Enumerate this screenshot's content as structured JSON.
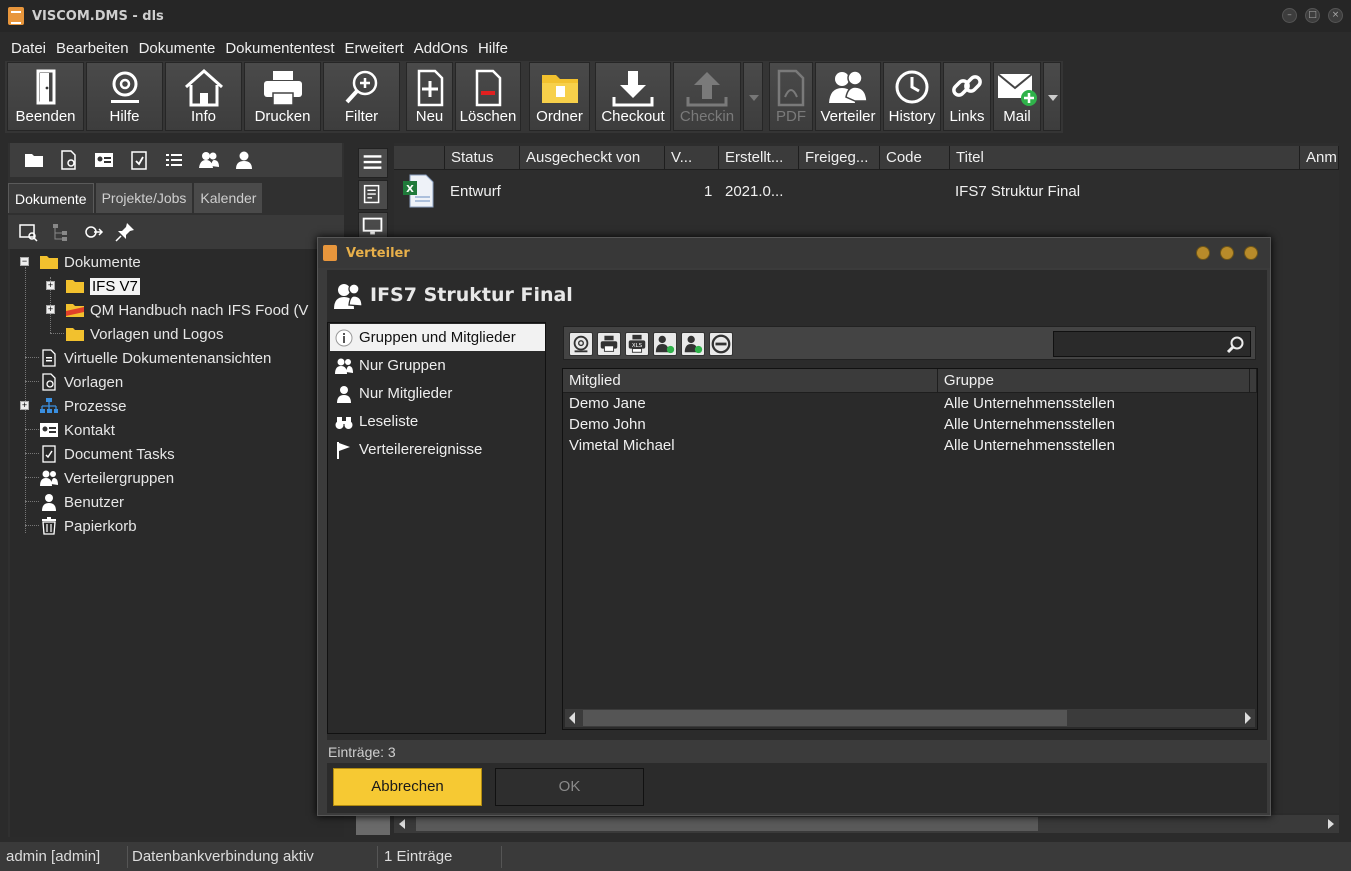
{
  "window": {
    "title": "VISCOM.DMS - dls"
  },
  "menu": [
    "Datei",
    "Bearbeiten",
    "Dokumente",
    "Dokumententest",
    "Erweitert",
    "AddOns",
    "Hilfe"
  ],
  "toolbar": {
    "beenden": "Beenden",
    "hilfe": "Hilfe",
    "info": "Info",
    "drucken": "Drucken",
    "filter": "Filter",
    "neu": "Neu",
    "loeschen": "Löschen",
    "ordner": "Ordner",
    "checkout": "Checkout",
    "checkin": "Checkin",
    "pdf": "PDF",
    "verteiler": "Verteiler",
    "history": "History",
    "links": "Links",
    "mail": "Mail"
  },
  "left_tabs": [
    "Dokumente",
    "Projekte/Jobs",
    "Kalender"
  ],
  "tree": {
    "dokumente": "Dokumente",
    "ifs": "IFS V7",
    "qm": "QM Handbuch nach IFS Food (V",
    "vorlagen_logos": "Vorlagen und Logos",
    "virtuelle": "Virtuelle Dokumentenansichten",
    "vorlagen": "Vorlagen",
    "prozesse": "Prozesse",
    "kontakt": "Kontakt",
    "tasks": "Document Tasks",
    "verteilergruppen": "Verteilergruppen",
    "benutzer": "Benutzer",
    "papierkorb": "Papierkorb"
  },
  "grid": {
    "columns": [
      "Status",
      "Ausgecheckt von",
      "V...",
      "Erstellt...",
      "Freigeg...",
      "Code",
      "Titel",
      "Anm"
    ],
    "row": {
      "status": "Entwurf",
      "version": "1",
      "created": "2021.0...",
      "title": "IFS7 Struktur Final"
    }
  },
  "dialog": {
    "title": "Verteiler",
    "header": "IFS7 Struktur Final",
    "nav": [
      "Gruppen und Mitglieder",
      "Nur Gruppen",
      "Nur Mitglieder",
      "Leseliste",
      "Verteilerereignisse"
    ],
    "columns": [
      "Mitglied",
      "Gruppe"
    ],
    "rows": [
      {
        "member": "Demo Jane",
        "group": "Alle Unternehmensstellen"
      },
      {
        "member": "Demo John",
        "group": "Alle Unternehmensstellen"
      },
      {
        "member": "Vimetal Michael",
        "group": "Alle Unternehmensstellen"
      }
    ],
    "count": "Einträge: 3",
    "cancel": "Abbrechen",
    "ok": "OK"
  },
  "status": {
    "user": "admin [admin]",
    "db": "Datenbankverbindung aktiv",
    "entries": "1 Einträge"
  },
  "colors": {
    "accent": "#f6c933",
    "background": "#2b2b2b",
    "panel": "#3b3b3b"
  }
}
